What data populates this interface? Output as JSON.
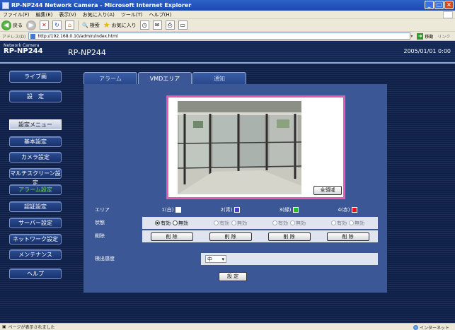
{
  "browser": {
    "title": "RP-NP244 Network Camera - Microsoft Internet Explorer",
    "menu": [
      "ファイル(F)",
      "編集(E)",
      "表示(V)",
      "お気に入り(A)",
      "ツール(T)",
      "ヘルプ(H)"
    ],
    "toolbar": {
      "back": "戻る",
      "search": "検索",
      "favorites": "お気に入り"
    },
    "address_label": "アドレス(D)",
    "address_url": "http://192.168.0.10/admin/index.html",
    "go_label": "移動",
    "links_label": "リンク",
    "status_text": "ページが表示されました",
    "zone_text": "インターネット"
  },
  "header": {
    "brand_line": "Network Camera",
    "brand_model": "RP-NP244",
    "model_title": "RP-NP244",
    "datetime": "2005/01/01  0:00"
  },
  "sidebar": {
    "live_label": "ライブ画",
    "settings_label": "設　定",
    "menu_title": "設定メニュー",
    "items": [
      "基本設定",
      "カメラ設定",
      "マルチスクリーン設定",
      "アラーム設定",
      "認証設定",
      "サーバー設定",
      "ネットワーク設定",
      "メンテナンス"
    ],
    "help_label": "ヘルプ"
  },
  "tabs": [
    "アラーム",
    "VMDエリア",
    "通知"
  ],
  "preview": {
    "full_area_label": "全領域"
  },
  "area_table": {
    "area_label": "エリア",
    "status_label": "状態",
    "delete_label": "削除",
    "areas": [
      {
        "name": "1(白)",
        "color": "#ffffff",
        "on": "有効",
        "off": "無効",
        "delete_btn": "削 除"
      },
      {
        "name": "2(青)",
        "color": "#4a3fc8",
        "on": "有効",
        "off": "無効",
        "delete_btn": "削 除"
      },
      {
        "name": "3(緑)",
        "color": "#1fc21f",
        "on": "有効",
        "off": "無効",
        "delete_btn": "削 除"
      },
      {
        "name": "4(赤)",
        "color": "#e01717",
        "on": "有効",
        "off": "無効",
        "delete_btn": "削 除"
      }
    ]
  },
  "sensitivity": {
    "label": "検出感度",
    "value": "中"
  },
  "set_button": "設 定",
  "colors": {
    "accent_pink": "#e55bb0",
    "active_menu_green": "#6de05a",
    "panel_blue": "#3b5796"
  }
}
